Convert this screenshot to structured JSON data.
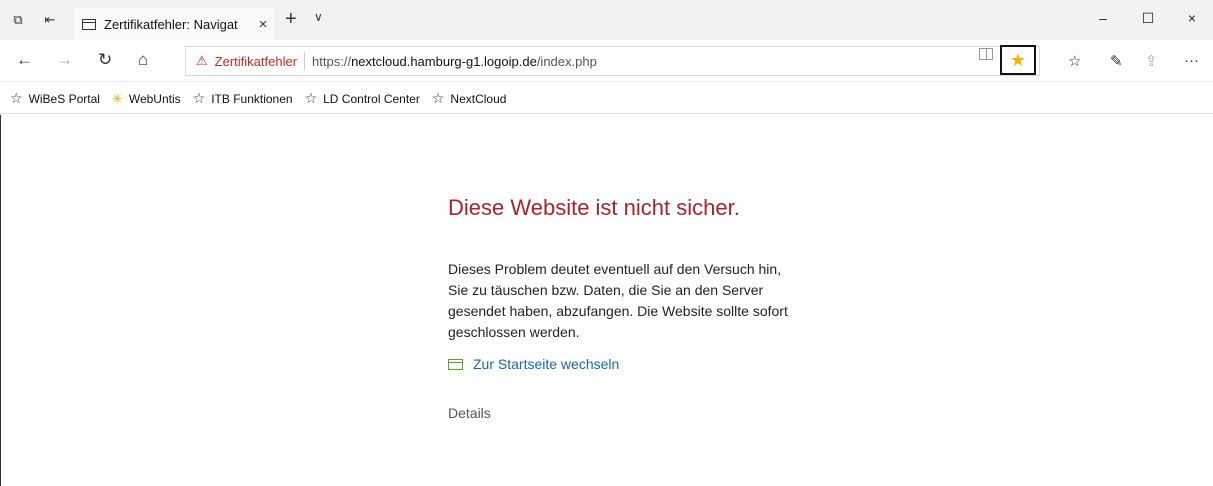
{
  "tab": {
    "title": "Zertifikatfehler: Navigat",
    "close_glyph": "×",
    "new_tab_glyph": "+",
    "tab_menu_glyph": "∨"
  },
  "window": {
    "minimize_glyph": "–",
    "maximize_glyph": "☐",
    "close_glyph": "×"
  },
  "toolbar": {
    "back_glyph": "←",
    "forward_glyph": "→",
    "refresh_glyph": "↻",
    "home_glyph": "⌂",
    "cert_warning_label": "Zertifikatfehler",
    "url_prefix": "https://",
    "url_host": "nextcloud.hamburg-g1.logoip.de",
    "url_path": "/index.php",
    "favorite_glyph": "★",
    "favorites_hub_glyph": "☆",
    "notes_glyph": "✎",
    "share_glyph": "⇪",
    "more_glyph": "···"
  },
  "favorites_bar": [
    {
      "label": "WiBeS Portal",
      "icon": "star-outline-icon"
    },
    {
      "label": "WebUntis",
      "icon": "webuntis-icon"
    },
    {
      "label": "ITB Funktionen",
      "icon": "star-outline-icon"
    },
    {
      "label": "LD Control Center",
      "icon": "star-outline-icon"
    },
    {
      "label": "NextCloud",
      "icon": "star-outline-icon"
    }
  ],
  "error_page": {
    "title": "Diese Website ist nicht sicher.",
    "body": "Dieses Problem deutet eventuell auf den Versuch hin, Sie zu täuschen bzw. Daten, die Sie an den Server gesendet haben, abzufangen. Die Website sollte sofort geschlossen werden.",
    "home_link": "Zur Startseite wechseln",
    "details": "Details"
  },
  "colors": {
    "error_title": "#a4262c",
    "link": "#1a64b4",
    "favorite_star": "#f3b400",
    "cert_warning": "#c42b1c"
  }
}
